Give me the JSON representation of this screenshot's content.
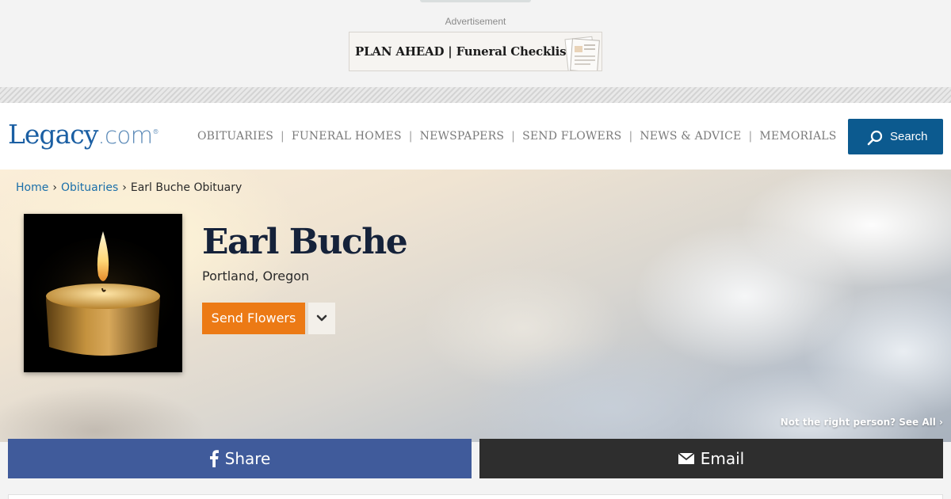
{
  "ad": {
    "label": "Advertisement",
    "banner_text": "PLAN AHEAD | Funeral Checklist"
  },
  "header": {
    "logo_main": "Legacy",
    "logo_suffix": ".com",
    "logo_reg": "®",
    "nav": [
      {
        "label": "OBITUARIES"
      },
      {
        "label": "FUNERAL HOMES"
      },
      {
        "label": "NEWSPAPERS"
      },
      {
        "label": "SEND FLOWERS"
      },
      {
        "label": "NEWS & ADVICE"
      },
      {
        "label": "MEMORIALS"
      }
    ],
    "nav_separator": "|",
    "search_label": "Search"
  },
  "breadcrumb": {
    "home": "Home",
    "obituaries": "Obituaries",
    "current": "Earl Buche Obituary",
    "separator": "›"
  },
  "person": {
    "name": "Earl Buche",
    "location": "Portland, Oregon"
  },
  "actions": {
    "send_flowers": "Send Flowers",
    "not_right_person": "Not the right person? See All ›",
    "share": "Share",
    "email": "Email"
  },
  "colors": {
    "brand_blue": "#0c5a8f",
    "link_blue": "#1b6fa9",
    "orange": "#ec7a15",
    "facebook": "#405b9b",
    "email_dark": "#2e2e2e"
  },
  "icons": {
    "search": "search-icon",
    "dropdown": "chevron-down-icon",
    "share": "facebook-icon",
    "email": "envelope-icon"
  }
}
